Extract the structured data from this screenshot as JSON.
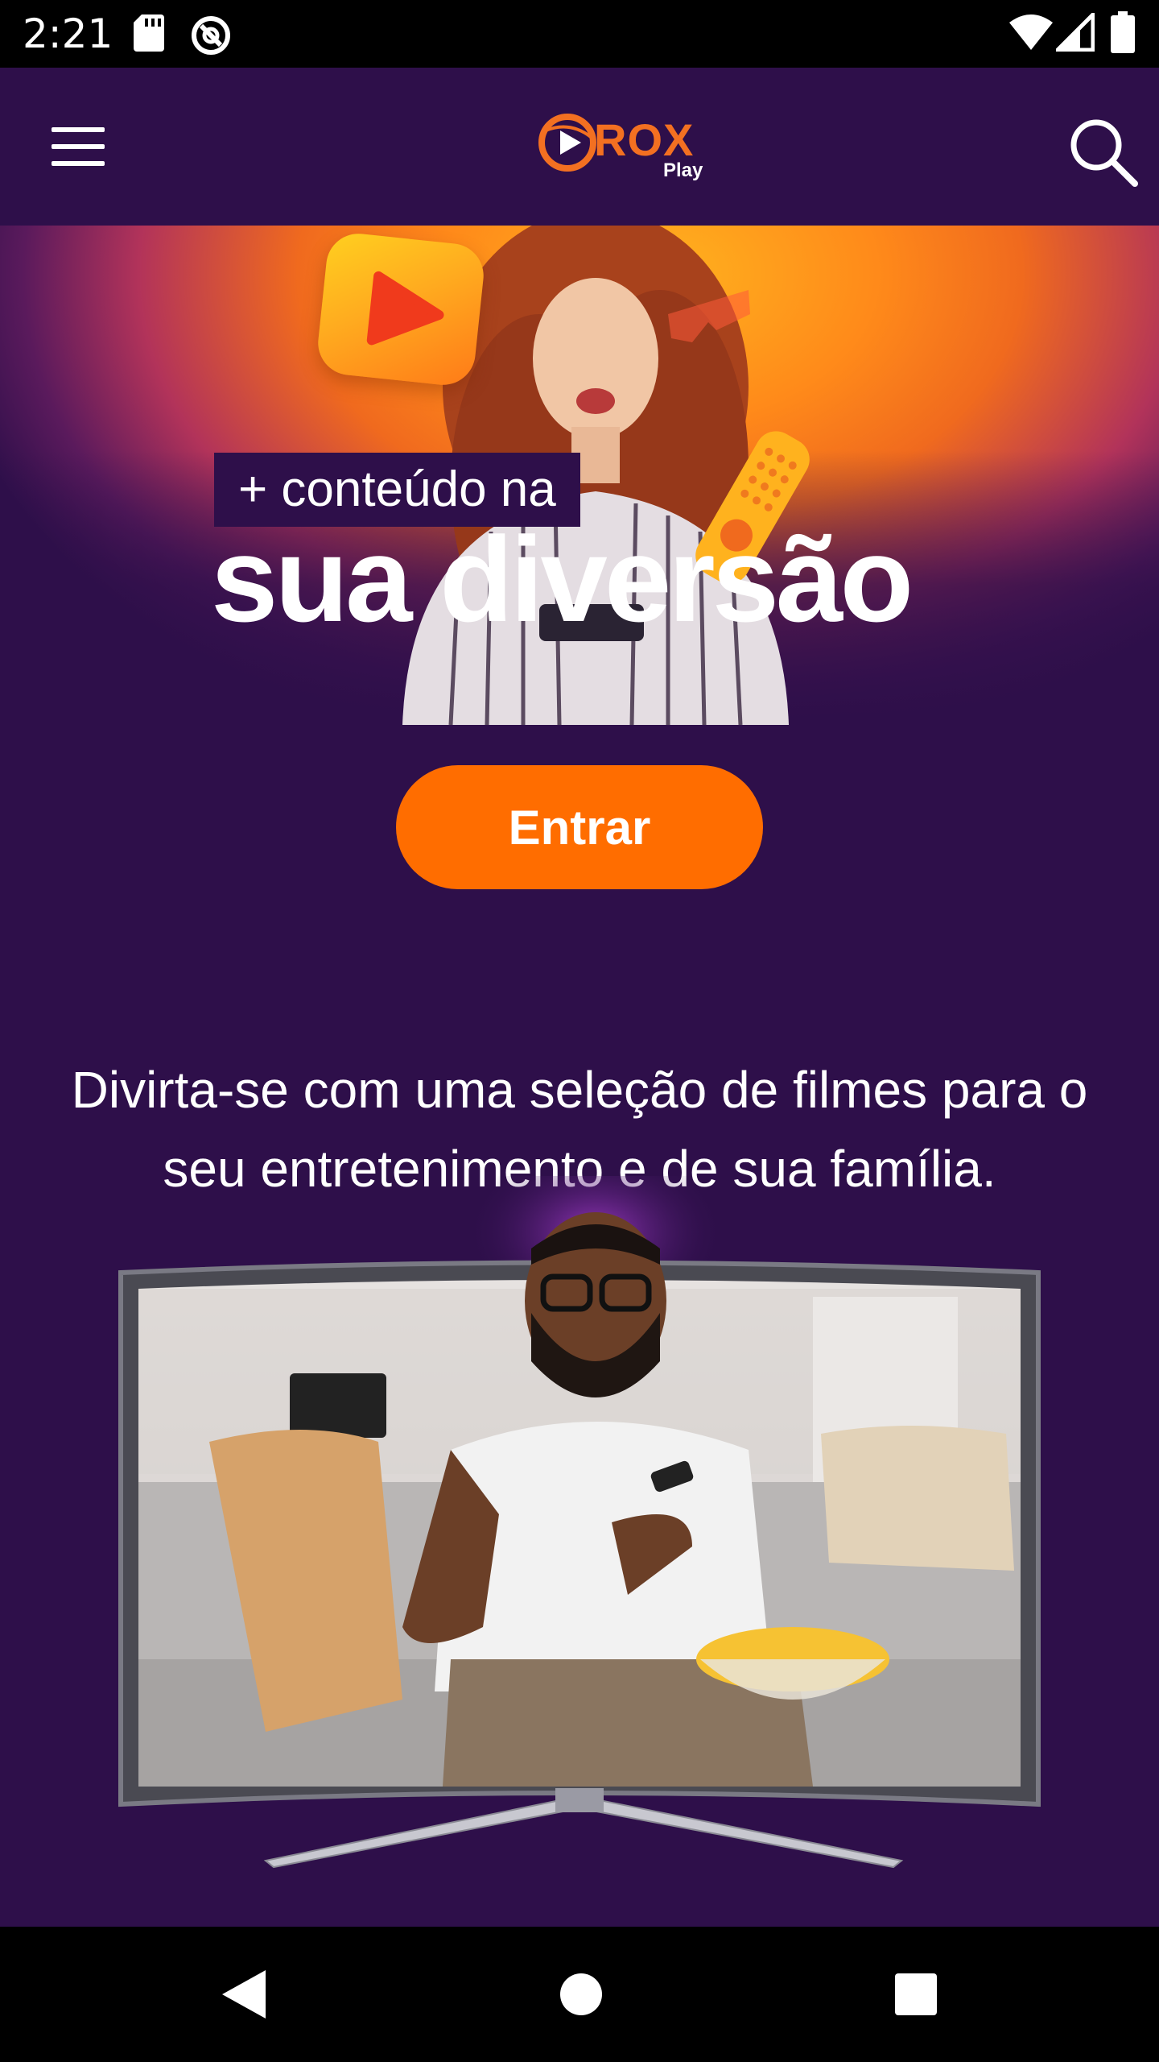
{
  "status_bar": {
    "time": "2:21",
    "icons": [
      "sd-card-icon",
      "sync-icon",
      "wifi-icon",
      "signal-icon",
      "battery-icon"
    ]
  },
  "header": {
    "menu_icon": "hamburger-menu-icon",
    "logo": {
      "brand": "ROX",
      "sub": "Play"
    },
    "search_icon": "search-icon"
  },
  "hero": {
    "kicker": "+ conteúdo na",
    "headline": "sua diversão"
  },
  "cta": {
    "label": "Entrar"
  },
  "description": "Divirta-se com uma seleção de filmes para o seu entretenimento e de sua família.",
  "nav_bar": {
    "icons": [
      "back-icon",
      "home-icon",
      "recents-icon"
    ]
  },
  "colors": {
    "background": "#2e0f4a",
    "accent": "#ff6d00",
    "logo_orange": "#f37021",
    "text": "#ffffff"
  }
}
